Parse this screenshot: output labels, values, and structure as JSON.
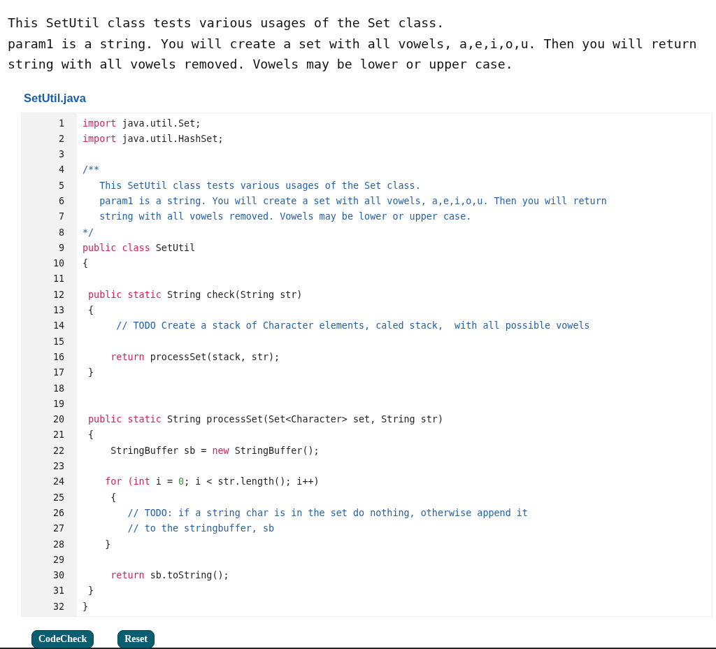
{
  "description": [
    "This SetUtil class tests various usages of the Set class.",
    "param1 is a string. You will create a set with all vowels, a,e,i,o,u. Then you will return",
    "string with all vowels removed. Vowels may be lower or upper case."
  ],
  "file": {
    "name": "SetUtil.java",
    "lines": [
      {
        "number": "1",
        "tokens": [
          {
            "kind": "keyword",
            "text": "import"
          },
          {
            "kind": "plain",
            "text": " java.util.Set;"
          }
        ]
      },
      {
        "number": "2",
        "tokens": [
          {
            "kind": "keyword",
            "text": "import"
          },
          {
            "kind": "plain",
            "text": " java.util.HashSet;"
          }
        ]
      },
      {
        "number": "3"
      },
      {
        "number": "4",
        "tokens": [
          {
            "kind": "comment",
            "text": "/**"
          }
        ]
      },
      {
        "number": "5",
        "tokens": [
          {
            "kind": "comment",
            "text": "   This SetUtil class tests various usages of the Set class."
          }
        ]
      },
      {
        "number": "6",
        "tokens": [
          {
            "kind": "comment",
            "text": "   param1 is a string. You will create a set with all vowels, a,e,i,o,u. Then you will return"
          }
        ]
      },
      {
        "number": "7",
        "tokens": [
          {
            "kind": "comment",
            "text": "   string with all vowels removed. Vowels may be lower or upper case."
          }
        ]
      },
      {
        "number": "8",
        "tokens": [
          {
            "kind": "comment",
            "text": "*/"
          }
        ]
      },
      {
        "number": "9",
        "tokens": [
          {
            "kind": "keyword",
            "text": "public class"
          },
          {
            "kind": "plain",
            "text": " SetUtil"
          }
        ]
      },
      {
        "number": "10",
        "tokens": [
          {
            "kind": "plain",
            "text": "{"
          }
        ]
      },
      {
        "number": "11"
      },
      {
        "number": "12",
        "tokens": [
          {
            "kind": "keyword",
            "text": " public static"
          },
          {
            "kind": "plain",
            "text": " String check(String str)"
          }
        ]
      },
      {
        "number": "13",
        "tokens": [
          {
            "kind": "plain",
            "text": " {"
          }
        ]
      },
      {
        "number": "14",
        "tokens": [
          {
            "kind": "comment",
            "text": "      // TODO Create a stack of Character elements, caled stack,  with all possible vowels"
          }
        ]
      },
      {
        "number": "15"
      },
      {
        "number": "16",
        "tokens": [
          {
            "kind": "keyword",
            "text": "     return"
          },
          {
            "kind": "plain",
            "text": " processSet(stack, str);"
          }
        ]
      },
      {
        "number": "17",
        "tokens": [
          {
            "kind": "plain",
            "text": " }"
          }
        ]
      },
      {
        "number": "18"
      },
      {
        "number": "19"
      },
      {
        "number": "20",
        "tokens": [
          {
            "kind": "keyword",
            "text": " public static"
          },
          {
            "kind": "plain",
            "text": " String processSet(Set<Character> set, String str)"
          }
        ]
      },
      {
        "number": "21",
        "tokens": [
          {
            "kind": "plain",
            "text": " {"
          }
        ]
      },
      {
        "number": "22",
        "tokens": [
          {
            "kind": "plain",
            "text": "     StringBuffer sb = "
          },
          {
            "kind": "keyword",
            "text": "new"
          },
          {
            "kind": "plain",
            "text": " StringBuffer();"
          }
        ]
      },
      {
        "number": "23"
      },
      {
        "number": "24",
        "tokens": [
          {
            "kind": "keyword",
            "text": "    for (int"
          },
          {
            "kind": "plain",
            "text": " i = "
          },
          {
            "kind": "number",
            "text": "0"
          },
          {
            "kind": "plain",
            "text": "; i < str.length(); i++)"
          }
        ]
      },
      {
        "number": "25",
        "tokens": [
          {
            "kind": "plain",
            "text": "     {"
          }
        ]
      },
      {
        "number": "26",
        "tokens": [
          {
            "kind": "comment",
            "text": "        // TODO: if a string char is in the set do nothing, otherwise append it"
          }
        ]
      },
      {
        "number": "27",
        "tokens": [
          {
            "kind": "comment",
            "text": "        // to the stringbuffer, sb"
          }
        ]
      },
      {
        "number": "28",
        "tokens": [
          {
            "kind": "plain",
            "text": "    }"
          }
        ]
      },
      {
        "number": "29"
      },
      {
        "number": "30",
        "tokens": [
          {
            "kind": "keyword",
            "text": "     return"
          },
          {
            "kind": "plain",
            "text": " sb.toString();"
          }
        ]
      },
      {
        "number": "31",
        "tokens": [
          {
            "kind": "plain",
            "text": " }"
          }
        ]
      },
      {
        "number": "32",
        "tokens": [
          {
            "kind": "plain",
            "text": "}"
          }
        ]
      }
    ]
  },
  "buttons": [
    "CodeCheck",
    "Reset"
  ]
}
